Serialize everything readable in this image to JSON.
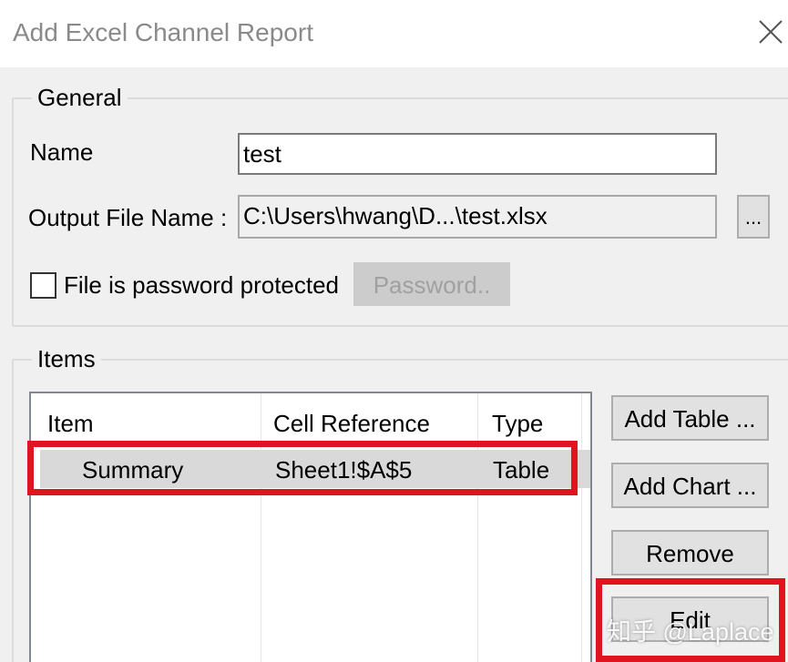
{
  "dialog": {
    "title": "Add Excel Channel Report",
    "close_icon": "close-icon"
  },
  "general": {
    "title": "General",
    "name_label": "Name",
    "name_value": "test",
    "output_label": "Output File Name :",
    "output_value": "C:\\Users\\hwang\\D...\\test.xlsx",
    "browse_label": "...",
    "password_checkbox_label": "File is password protected",
    "password_checked": false,
    "password_button_label": "Password.."
  },
  "items": {
    "title": "Items",
    "columns": [
      "Item",
      "Cell Reference",
      "Type"
    ],
    "rows": [
      {
        "item": "Summary",
        "cell_reference": "Sheet1!$A$5",
        "type": "Table"
      }
    ],
    "buttons": {
      "add_table": "Add Table ...",
      "add_chart": "Add Chart ...",
      "remove": "Remove",
      "edit": "Edit"
    }
  },
  "annotation": {
    "highlight_color": "#e0141e"
  },
  "watermark": "知乎 @Laplace"
}
